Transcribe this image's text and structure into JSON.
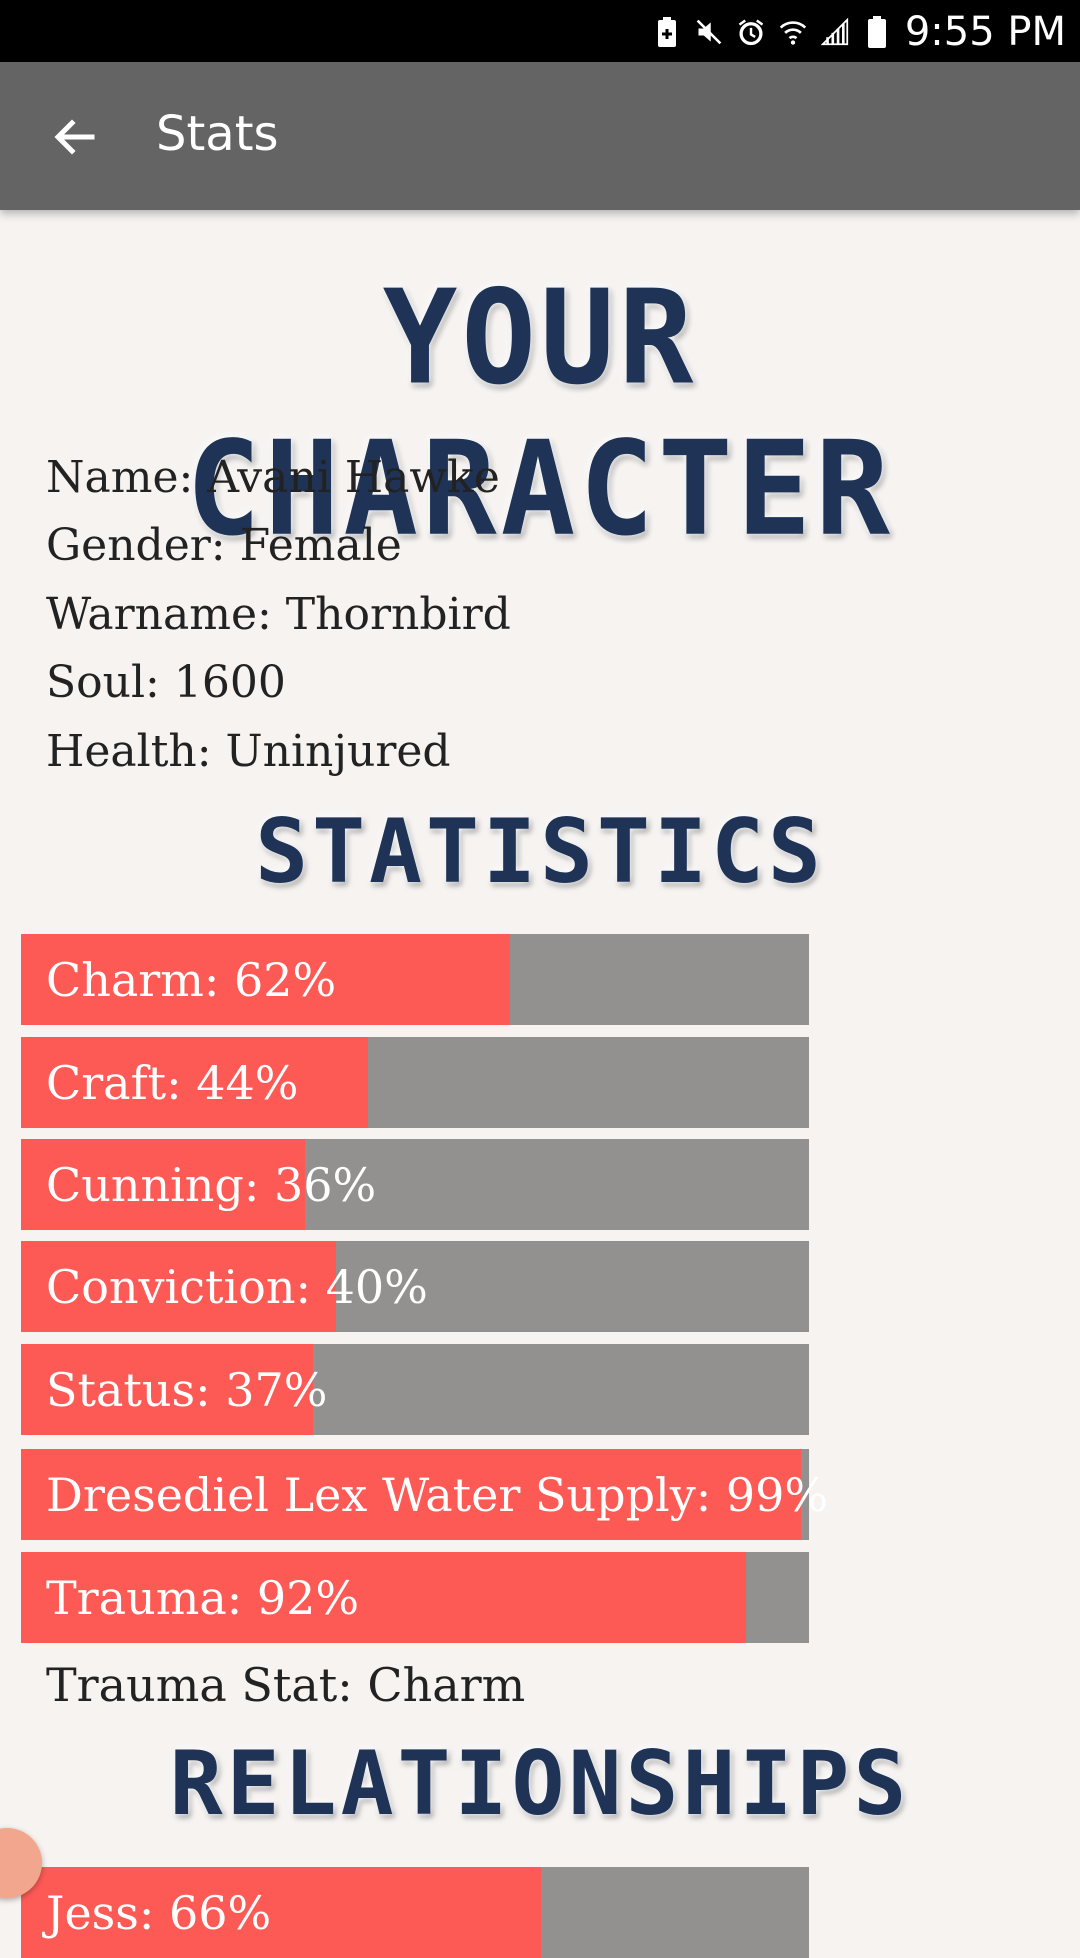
{
  "status_bar": {
    "time": "9:55 PM",
    "icons": [
      "battery-saver-icon",
      "mute-icon",
      "alarm-icon",
      "wifi-icon",
      "signal-icon",
      "battery-icon"
    ]
  },
  "app_bar": {
    "title": "Stats",
    "back_icon": "arrow-left-icon"
  },
  "headings": {
    "character": "YOUR CHARACTER",
    "statistics": "STATISTICS",
    "relationships": "RELATIONSHIPS"
  },
  "character": {
    "name": "Name: Avani Hawke",
    "gender": "Gender: Female",
    "warname": "Warname: Thornbird",
    "soul": "Soul: 1600",
    "health": "Health: Uninjured"
  },
  "stats": [
    {
      "label": "Charm: 62%",
      "value": 62
    },
    {
      "label": "Craft: 44%",
      "value": 44
    },
    {
      "label": "Cunning: 36%",
      "value": 36
    },
    {
      "label": "Conviction: 40%",
      "value": 40
    },
    {
      "label": "Status: 37%",
      "value": 37
    },
    {
      "label": "Dresediel Lex Water Supply: 99%",
      "value": 99
    },
    {
      "label": "Trauma: 92%",
      "value": 92
    }
  ],
  "trauma_stat": "Trauma Stat: Charm",
  "relationships": [
    {
      "label": "Jess: 66%",
      "value": 66
    }
  ],
  "colors": {
    "fill": "#fd5a56",
    "track": "#939190",
    "app_bar": "#646464",
    "heading": "#1f3356",
    "background": "#f6f3f1"
  }
}
